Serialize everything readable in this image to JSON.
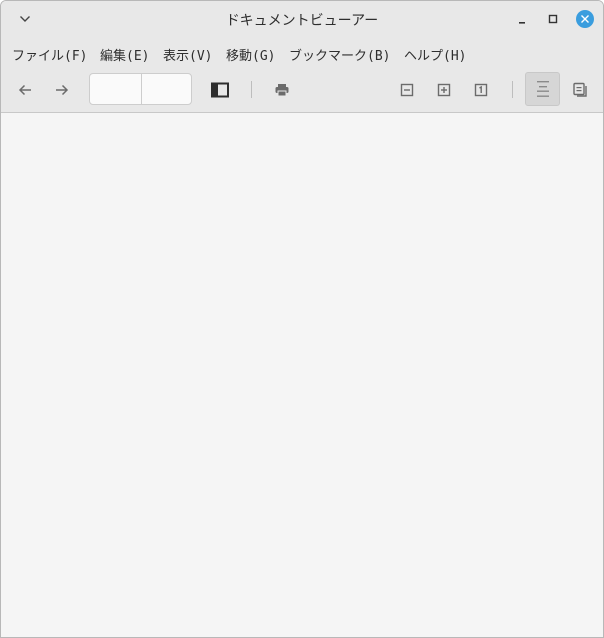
{
  "window": {
    "title": "ドキュメントビューアー"
  },
  "menubar": {
    "items": [
      {
        "label": "ファイル(F)"
      },
      {
        "label": "編集(E)"
      },
      {
        "label": "表示(V)"
      },
      {
        "label": "移動(G)"
      },
      {
        "label": "ブックマーク(B)"
      },
      {
        "label": "ヘルプ(H)"
      }
    ]
  },
  "toolbar": {
    "page_number": "",
    "page_total": ""
  },
  "icons": {
    "window_menu": "chevron-down-icon",
    "minimize": "minimize-icon",
    "maximize": "maximize-icon",
    "close": "close-icon",
    "back": "arrow-left-icon",
    "forward": "arrow-right-icon",
    "sidebar": "sidebar-icon",
    "print": "printer-icon",
    "zoom_out": "zoom-out-icon",
    "zoom_in": "zoom-in-icon",
    "zoom_fit": "zoom-original-icon",
    "continuous": "continuous-view-icon",
    "dual": "dual-page-icon"
  },
  "colors": {
    "close_button": "#3a9dde",
    "chrome": "#e8e8e8",
    "canvas": "#f5f5f5",
    "icon": "#6b6b6b"
  }
}
